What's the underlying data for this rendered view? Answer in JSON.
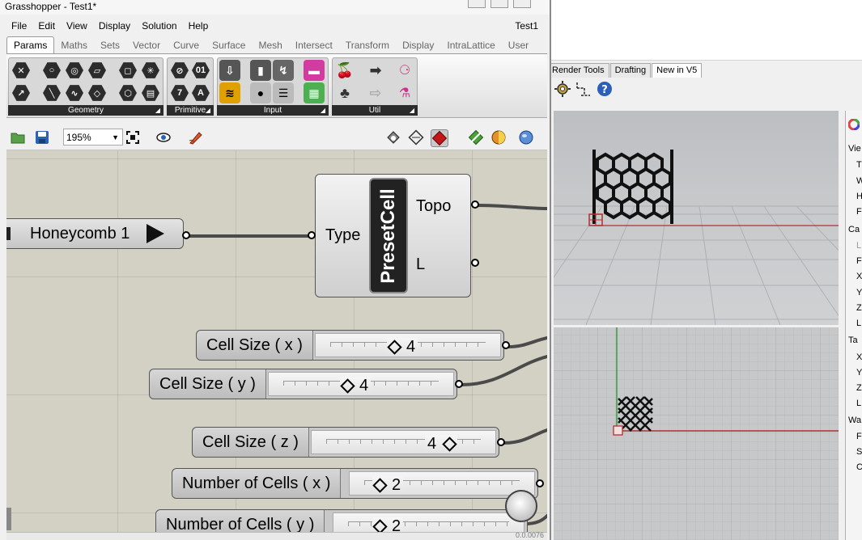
{
  "grasshopper": {
    "title": "Grasshopper - Test1*",
    "document_name": "Test1",
    "menu": [
      "File",
      "Edit",
      "View",
      "Display",
      "Solution",
      "Help"
    ],
    "tabs": [
      "Params",
      "Maths",
      "Sets",
      "Vector",
      "Curve",
      "Surface",
      "Mesh",
      "Intersect",
      "Transform",
      "Display",
      "IntraLattice",
      "User"
    ],
    "active_tab": "Params",
    "ribbon_groups": [
      "Geometry",
      "Primitive",
      "Input",
      "Util"
    ],
    "primitive_icon_labels": [
      "01",
      "7",
      "A"
    ],
    "zoom": "195%",
    "status_text": "0.0.0076"
  },
  "canvas": {
    "preset_source": {
      "label": "Honeycomb 1"
    },
    "preset_component": {
      "name": "PresetCell",
      "input": "Type",
      "outputs": [
        "Topo",
        "L"
      ]
    },
    "sliders": [
      {
        "label": "Cell Size ( x )",
        "value": "4"
      },
      {
        "label": "Cell Size ( y )",
        "value": "4"
      },
      {
        "label": "Cell Size ( z )",
        "value": "4"
      },
      {
        "label": "Number of Cells ( x )",
        "value": "2"
      },
      {
        "label": "Number of Cells ( y )",
        "value": "2"
      }
    ]
  },
  "rhino": {
    "tabs": [
      "Render Tools",
      "Drafting",
      "New in V5"
    ],
    "side_panel_labels": [
      "Vie",
      "T",
      "W",
      "H",
      "F",
      "Ca",
      "L",
      "F",
      "X",
      "Y",
      "Z",
      "L",
      "Ta",
      "X",
      "Y",
      "Z",
      "L",
      "Wa",
      "F",
      "S",
      "C"
    ]
  },
  "colors": {
    "canvas": "#d3d0c4",
    "component_body": "#dcdcdc",
    "preset_label_bg": "#222222",
    "wire": "#4a4a4a",
    "viewport": "#c6c8ca",
    "x_axis": "#b23030",
    "y_axis": "#3a9a3a"
  }
}
